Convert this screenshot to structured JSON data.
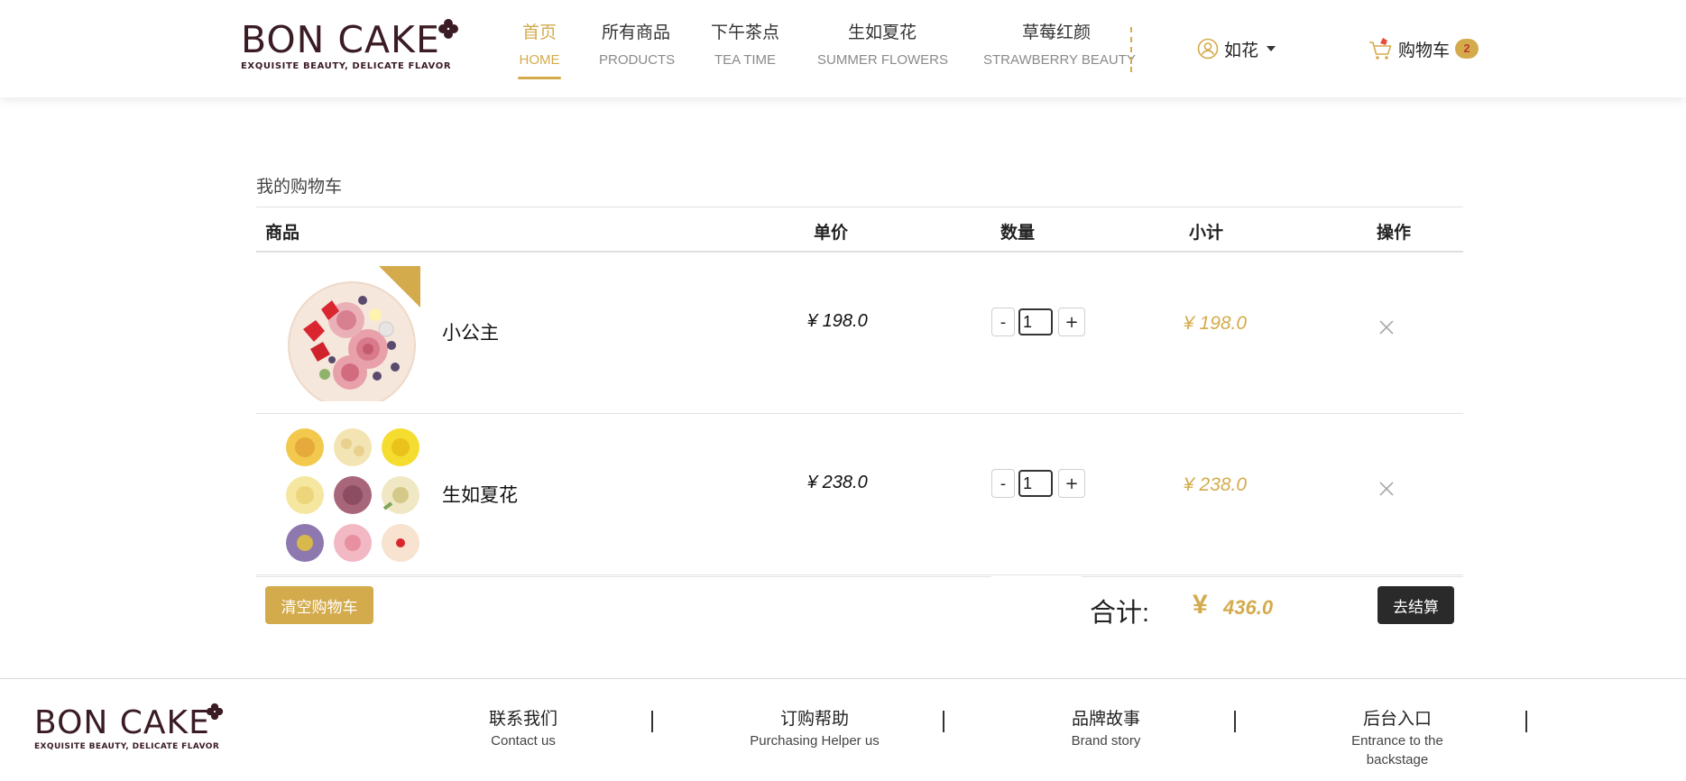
{
  "brand": {
    "name": "BON CAKE",
    "tagline": "EXQUISITE BEAUTY, DELICATE FLAVOR"
  },
  "nav": [
    {
      "zh": "首页",
      "en": "HOME",
      "active": true
    },
    {
      "zh": "所有商品",
      "en": "PRODUCTS"
    },
    {
      "zh": "下午茶点",
      "en": "TEA TIME"
    },
    {
      "zh": "生如夏花",
      "en": "SUMMER FLOWERS"
    },
    {
      "zh": "草莓红颜",
      "en": "STRAWBERRY BEAUTY"
    }
  ],
  "user": {
    "name": "如花",
    "icon": "user-circle-icon"
  },
  "cart": {
    "label": "购物车",
    "count": "2",
    "icon": "shopping-cart-icon"
  },
  "page": {
    "title": "我的购物车"
  },
  "table": {
    "headers": {
      "product": "商品",
      "price": "单价",
      "quantity": "数量",
      "subtotal": "小计",
      "action": "操作"
    },
    "rows": [
      {
        "name": "小公主",
        "price": "¥ 198.0",
        "quantity": "1",
        "subtotal": "¥ 198.0",
        "image": "strawberry-flower-cake-image"
      },
      {
        "name": "生如夏花",
        "price": "¥ 238.0",
        "quantity": "1",
        "subtotal": "¥ 238.0",
        "image": "flower-cupcakes-image"
      }
    ],
    "minus_label": "-",
    "plus_label": "+"
  },
  "summary": {
    "clear_label": "清空购物车",
    "total_label": "合计:",
    "currency": "¥",
    "total_value": "436.0",
    "checkout_label": "去结算"
  },
  "footer": {
    "links": [
      {
        "zh": "联系我们",
        "en": "Contact us"
      },
      {
        "zh": "订购帮助",
        "en": "Purchasing Helper us"
      },
      {
        "zh": "品牌故事",
        "en": "Brand story"
      },
      {
        "zh": "后台入口",
        "en": "Entrance to the backstage"
      }
    ]
  },
  "colors": {
    "accent": "#d4ab4c",
    "dark": "#2a2a2a",
    "brand": "#3b1c24"
  }
}
